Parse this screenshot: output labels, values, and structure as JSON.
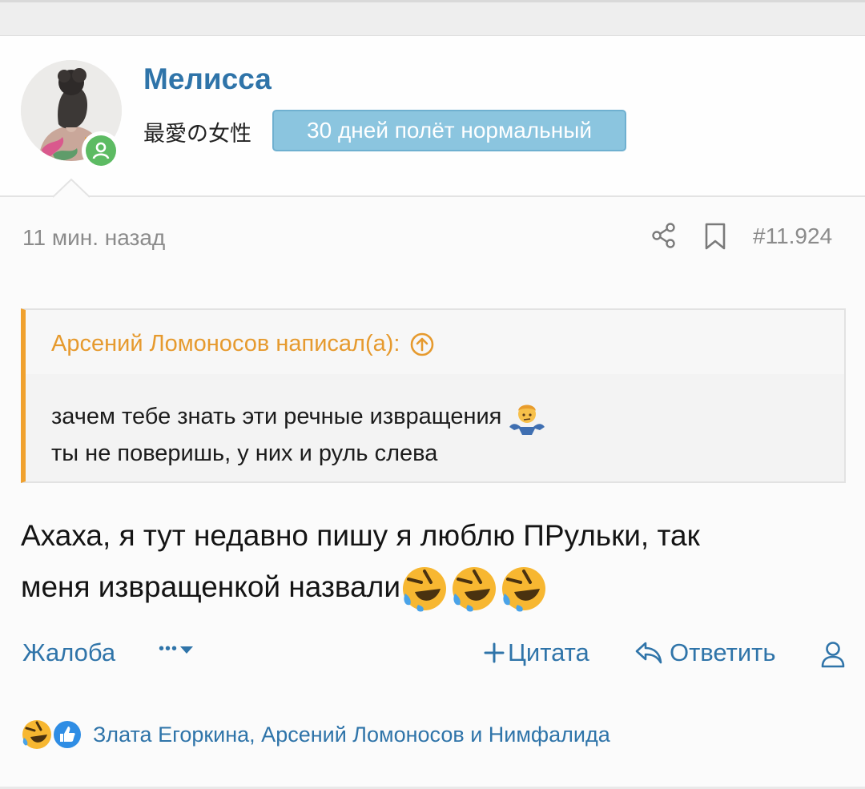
{
  "user": {
    "name": "Мелисса",
    "title": "最愛の女性",
    "banner": "30 дней полёт нормальный"
  },
  "post": {
    "time": "11 мин. назад",
    "number": "#11.924"
  },
  "quote": {
    "author": "Арсений Ломоносов написал(а):",
    "line1": "зачем тебе знать эти речные извращения",
    "line2": "ты не поверишь, у них и руль слева"
  },
  "message": {
    "line1": "Ахаха, я тут недавно пишу я люблю ПРульки, так",
    "line2": "меня извращенкой назвали"
  },
  "actions": {
    "report": "Жалоба",
    "more": "•••",
    "quote": "Цитата",
    "reply": "Ответить"
  },
  "reactions": {
    "names": "Злата Егоркина, Арсений Ломоносов и Нимфалида"
  },
  "colors": {
    "link": "#2f74a9",
    "quote_accent": "#f0a12e",
    "banner": "#8bc5df",
    "online": "#5dbb63"
  }
}
